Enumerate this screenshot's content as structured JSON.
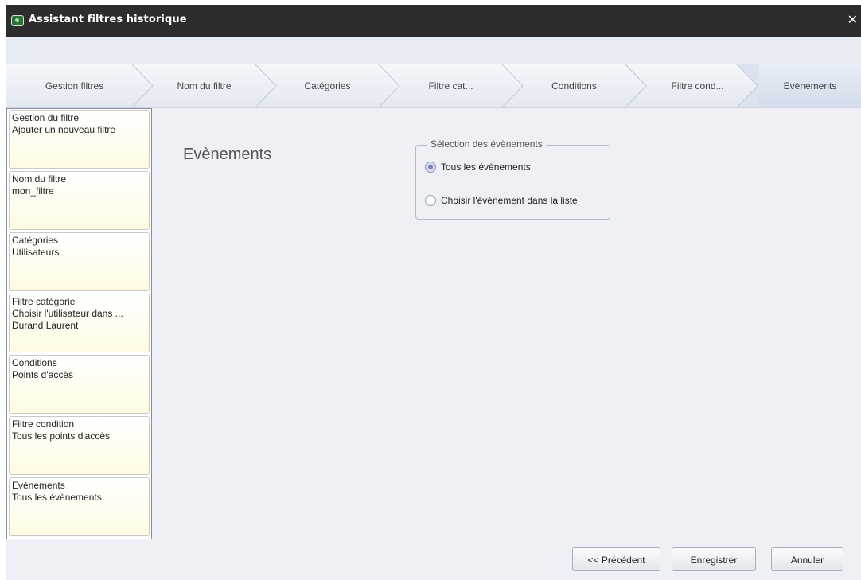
{
  "window": {
    "title": "Assistant filtres historique",
    "close_glyph": "✕"
  },
  "breadcrumb": {
    "steps": [
      {
        "label": "Gestion filtres",
        "active": false
      },
      {
        "label": "Nom du filtre",
        "active": false
      },
      {
        "label": "Catégories",
        "active": false
      },
      {
        "label": "Filtre cat...",
        "active": false
      },
      {
        "label": "Conditions",
        "active": false
      },
      {
        "label": "Filtre cond...",
        "active": false
      },
      {
        "label": "Evènements",
        "active": true
      }
    ]
  },
  "sidebar": {
    "cards": [
      {
        "title": "Gestion du filtre",
        "lines": [
          "Ajouter un nouveau filtre"
        ]
      },
      {
        "title": "Nom du filtre",
        "lines": [
          "mon_filtre"
        ]
      },
      {
        "title": "Catégories",
        "lines": [
          "Utilisateurs"
        ]
      },
      {
        "title": "Filtre catégorie",
        "lines": [
          "Choisir l'utilisateur dans ...",
          "Durand Laurent"
        ]
      },
      {
        "title": "Conditions",
        "lines": [
          "Points d'accès"
        ]
      },
      {
        "title": "Filtre condition",
        "lines": [
          "Tous les points d'accès"
        ]
      },
      {
        "title": "Evènements",
        "lines": [
          "Tous les évènements"
        ]
      }
    ]
  },
  "main": {
    "title": "Evènements",
    "selection": {
      "legend": "Sélection des évènements",
      "options": [
        {
          "label": "Tous les évènements",
          "checked": true
        },
        {
          "label": "Choisir l'évènement dans la liste",
          "checked": false
        }
      ]
    }
  },
  "footer": {
    "previous_label": "<< Précédent",
    "save_label": "Enregistrer",
    "cancel_label": "Annuler"
  }
}
